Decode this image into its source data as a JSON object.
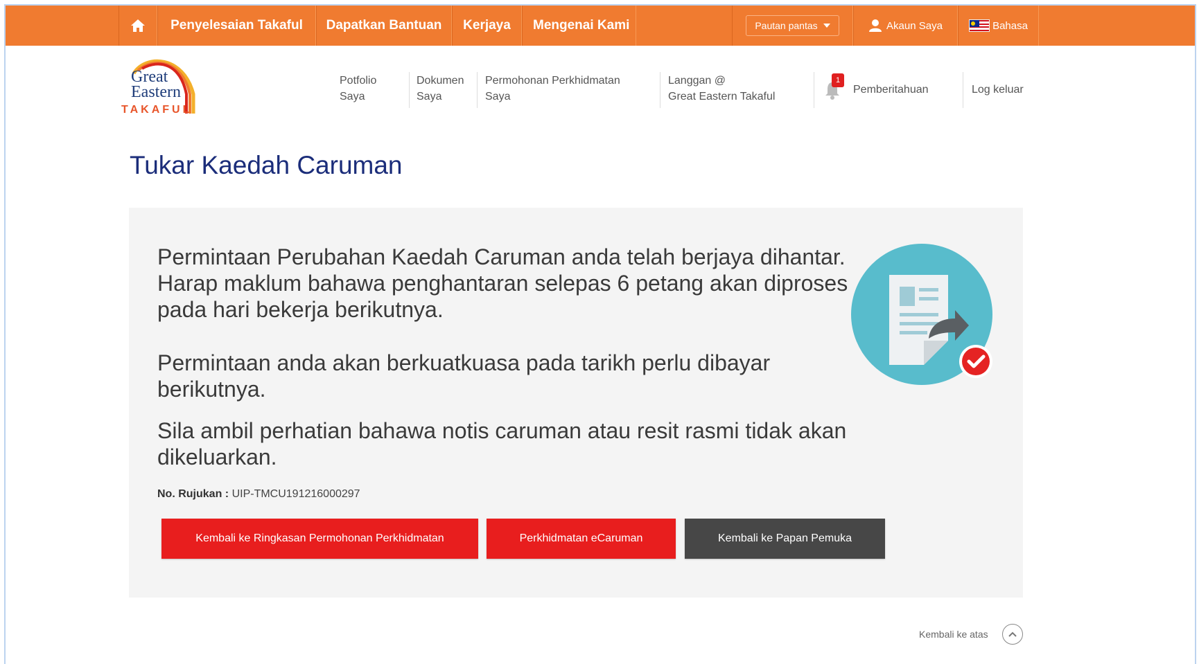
{
  "topnav": {
    "items": [
      "Penyelesaian Takaful",
      "Dapatkan Bantuan",
      "Kerjaya",
      "Mengenai Kami"
    ],
    "quick_links": "Pautan pantas",
    "account": "Akaun Saya",
    "language": "Bahasa",
    "accent": "#f07b30"
  },
  "logo": {
    "line1": "Great",
    "line2": "Eastern",
    "line3": "TAKAFUL"
  },
  "mainnav": {
    "portfolio_l1": "Potfolio",
    "portfolio_l2": "Saya",
    "documents_l1": "Dokumen",
    "documents_l2": "Saya",
    "service_l1": "Permohonan Perkhidmatan",
    "service_l2": "Saya",
    "subscribe_l1": "Langgan @",
    "subscribe_l2": "Great Eastern Takaful",
    "notif_count": "1",
    "notifications": "Pemberitahuan",
    "logout": "Log keluar"
  },
  "page": {
    "title": "Tukar Kaedah Caruman",
    "message1": "Permintaan Perubahan Kaedah Caruman anda telah berjaya dihantar. Harap maklum bahawa penghantaran selepas 6 petang akan diproses pada hari bekerja berikutnya.",
    "message2": "Permintaan anda akan berkuatkuasa pada tarikh perlu dibayar berikutnya.",
    "message3": "Sila ambil perhatian bahawa notis caruman atau resit rasmi tidak akan dikeluarkan.",
    "ref_label": "No. Rujukan :",
    "ref_value": "UIP-TMCU191216000297"
  },
  "buttons": {
    "back_summary": "Kembali ke Ringkasan Permohonan Perkhidmatan",
    "ecaruman": "Perkhidmatan eCaruman",
    "dashboard": "Kembali ke Papan Pemuka"
  },
  "footer": {
    "back_to_top": "Kembali ke atas"
  }
}
